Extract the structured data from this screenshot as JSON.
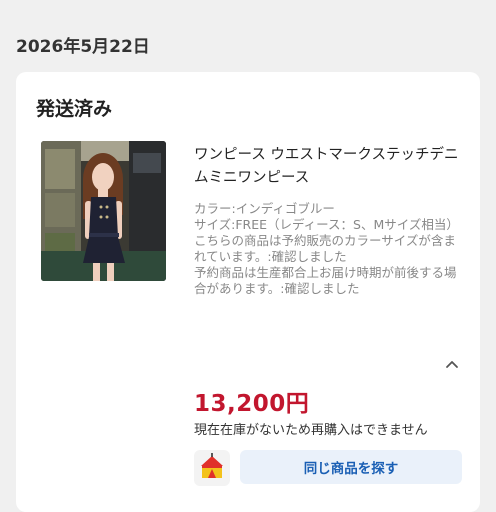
{
  "order": {
    "date": "2026年5月22日",
    "status": "発送済み"
  },
  "item": {
    "title": "ワンピース ウエストマークステッチデニムミニワンピース",
    "spec": "カラー:インディゴブルー\nサイズ:FREE（レディース：S、Mサイズ相当）\nこちらの商品は予約販売のカラーサイズが含まれています。:確認しました\n予約商品は生産都合上お届け時期が前後する場合があります。:確認しました",
    "price": "13,200円",
    "stock_note": "現在在庫がないため再購入はできません",
    "find_button": "同じ商品を探す"
  },
  "icons": {
    "collapse": "chevron-up-icon",
    "shop": "shop-tent-icon"
  },
  "colors": {
    "price": "#c2162e",
    "button_text": "#1a5fb4",
    "button_bg": "#eaf1fa"
  }
}
